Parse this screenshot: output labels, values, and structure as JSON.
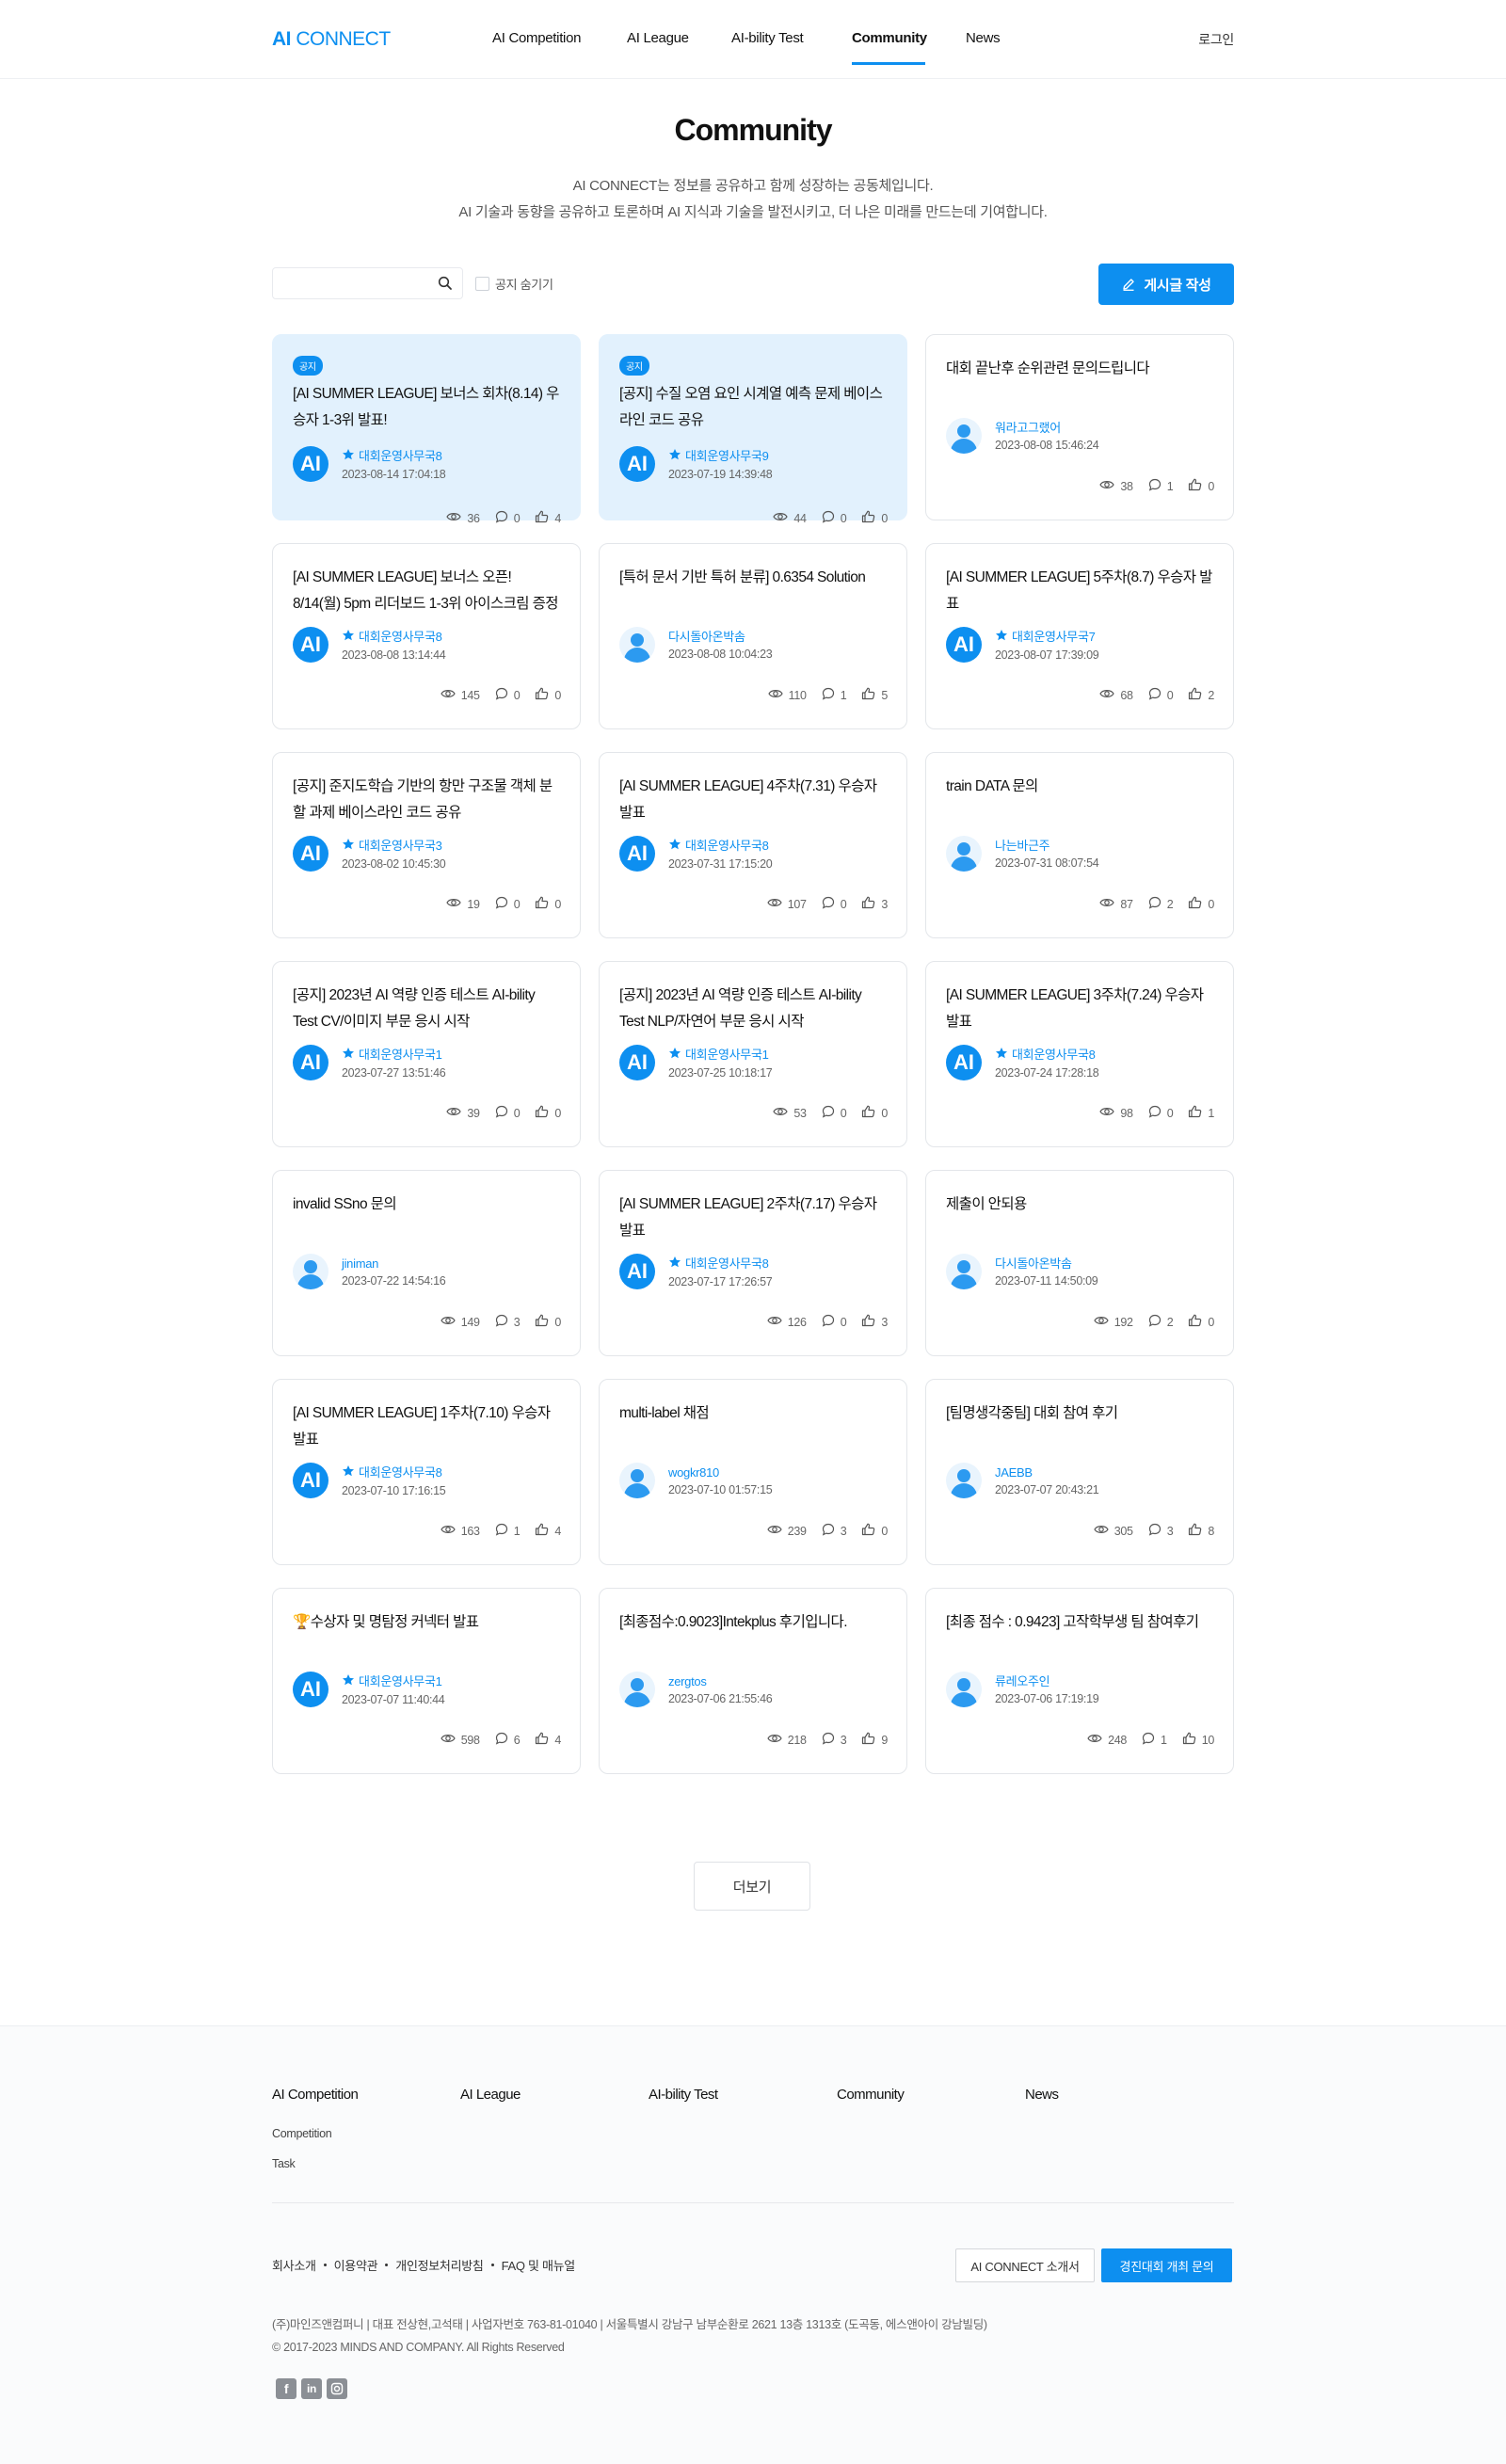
{
  "header": {
    "logo_bold": "AI",
    "logo_rest": " CONNECT",
    "nav": [
      "AI Competition",
      "AI League",
      "AI-bility Test",
      "Community",
      "News"
    ],
    "login": "로그인"
  },
  "intro": {
    "title": "Community",
    "line1": "AI CONNECT는 정보를 공유하고 함께 성장하는 공동체입니다.",
    "line2": "AI 기술과 동향을 공유하고 토론하며 AI 지식과 기술을 발전시키고, 더 나은 미래를 만드는데 기여합니다."
  },
  "toolbar": {
    "search_placeholder": "",
    "hide_notice_label": "공지 숨기기",
    "write_label": "게시글 작성"
  },
  "badge_label": "공지",
  "avatar_ai_text": "AI",
  "posts": [
    {
      "notice": true,
      "title": "[AI SUMMER LEAGUE] 보너스 회차(8.14) 우승자 1-3위 발표!",
      "author": "대회운영사무국8",
      "official": true,
      "date": "2023-08-14 17:04:18",
      "views": "36",
      "comments": "0",
      "likes": "4"
    },
    {
      "notice": true,
      "title": "[공지] 수질 오염 요인 시계열 예측 문제 베이스라인 코드 공유",
      "author": "대회운영사무국9",
      "official": true,
      "date": "2023-07-19 14:39:48",
      "views": "44",
      "comments": "0",
      "likes": "0"
    },
    {
      "notice": false,
      "title": "대회 끝난후 순위관련 문의드립니다",
      "author": "워라고그랬어",
      "official": false,
      "date": "2023-08-08 15:46:24",
      "views": "38",
      "comments": "1",
      "likes": "0"
    },
    {
      "notice": false,
      "title": "[AI SUMMER LEAGUE] 보너스 오픈! 8/14(월) 5pm 리더보드 1-3위 아이스크림 증정 🍨",
      "author": "대회운영사무국8",
      "official": true,
      "date": "2023-08-08 13:14:44",
      "views": "145",
      "comments": "0",
      "likes": "0"
    },
    {
      "notice": false,
      "title": "[특허 문서 기반 특허 분류] 0.6354 Solution",
      "author": "다시돌아온박솜",
      "official": false,
      "date": "2023-08-08 10:04:23",
      "views": "110",
      "comments": "1",
      "likes": "5"
    },
    {
      "notice": false,
      "title": "[AI SUMMER LEAGUE] 5주차(8.7) 우승자 발표",
      "author": "대회운영사무국7",
      "official": true,
      "date": "2023-08-07 17:39:09",
      "views": "68",
      "comments": "0",
      "likes": "2"
    },
    {
      "notice": false,
      "title": "[공지] 준지도학습 기반의 항만 구조물 객체 분할 과제 베이스라인 코드 공유",
      "author": "대회운영사무국3",
      "official": true,
      "date": "2023-08-02 10:45:30",
      "views": "19",
      "comments": "0",
      "likes": "0"
    },
    {
      "notice": false,
      "title": "[AI SUMMER LEAGUE] 4주차(7.31) 우승자 발표",
      "author": "대회운영사무국8",
      "official": true,
      "date": "2023-07-31 17:15:20",
      "views": "107",
      "comments": "0",
      "likes": "3"
    },
    {
      "notice": false,
      "title": "train DATA 문의",
      "author": "나는바근주",
      "official": false,
      "date": "2023-07-31 08:07:54",
      "views": "87",
      "comments": "2",
      "likes": "0"
    },
    {
      "notice": false,
      "title": "[공지] 2023년 AI 역량 인증 테스트 AI-bility Test CV/이미지 부문 응시 시작",
      "author": "대회운영사무국1",
      "official": true,
      "date": "2023-07-27 13:51:46",
      "views": "39",
      "comments": "0",
      "likes": "0"
    },
    {
      "notice": false,
      "title": "[공지] 2023년 AI 역량 인증 테스트 AI-bility Test NLP/자연어 부문 응시 시작",
      "author": "대회운영사무국1",
      "official": true,
      "date": "2023-07-25 10:18:17",
      "views": "53",
      "comments": "0",
      "likes": "0"
    },
    {
      "notice": false,
      "title": "[AI SUMMER LEAGUE] 3주차(7.24) 우승자 발표",
      "author": "대회운영사무국8",
      "official": true,
      "date": "2023-07-24 17:28:18",
      "views": "98",
      "comments": "0",
      "likes": "1"
    },
    {
      "notice": false,
      "title": "invalid SSno 문의",
      "author": "jiniman",
      "official": false,
      "date": "2023-07-22 14:54:16",
      "views": "149",
      "comments": "3",
      "likes": "0"
    },
    {
      "notice": false,
      "title": "[AI SUMMER LEAGUE] 2주차(7.17) 우승자 발표",
      "author": "대회운영사무국8",
      "official": true,
      "date": "2023-07-17 17:26:57",
      "views": "126",
      "comments": "0",
      "likes": "3"
    },
    {
      "notice": false,
      "title": "제출이 안되용",
      "author": "다시돌아온박솜",
      "official": false,
      "date": "2023-07-11 14:50:09",
      "views": "192",
      "comments": "2",
      "likes": "0"
    },
    {
      "notice": false,
      "title": "[AI SUMMER LEAGUE] 1주차(7.10) 우승자 발표",
      "author": "대회운영사무국8",
      "official": true,
      "date": "2023-07-10 17:16:15",
      "views": "163",
      "comments": "1",
      "likes": "4"
    },
    {
      "notice": false,
      "title": "multi-label 채점",
      "author": "wogkr810",
      "official": false,
      "date": "2023-07-10 01:57:15",
      "views": "239",
      "comments": "3",
      "likes": "0"
    },
    {
      "notice": false,
      "title": "[팀명생각중팀] 대회 참여 후기",
      "author": "JAEBB",
      "official": false,
      "date": "2023-07-07 20:43:21",
      "views": "305",
      "comments": "3",
      "likes": "8"
    },
    {
      "notice": false,
      "title": "🏆수상자 및 명탐정 커넥터 발표",
      "author": "대회운영사무국1",
      "official": true,
      "date": "2023-07-07 11:40:44",
      "views": "598",
      "comments": "6",
      "likes": "4"
    },
    {
      "notice": false,
      "title": "[최종점수:0.9023]Intekplus 후기입니다.",
      "author": "zergtos",
      "official": false,
      "date": "2023-07-06 21:55:46",
      "views": "218",
      "comments": "3",
      "likes": "9"
    },
    {
      "notice": false,
      "title": "[최종 점수 : 0.9423] 고작학부생 팀 참여후기",
      "author": "류레오주인",
      "official": false,
      "date": "2023-07-06 17:19:19",
      "views": "248",
      "comments": "1",
      "likes": "10"
    }
  ],
  "more_label": "더보기",
  "footer": {
    "columns": [
      "AI Competition",
      "AI League",
      "AI-bility Test",
      "Community",
      "News"
    ],
    "competition_sub": [
      "Competition",
      "Task"
    ],
    "links": [
      "회사소개",
      "이용약관",
      "개인정보처리방침",
      "FAQ 및 매뉴얼"
    ],
    "btn_intro": "AI CONNECT 소개서",
    "btn_inquiry": "경진대회 개최 문의",
    "company_info": "(주)마인즈앤컴퍼니 | 대표 전상현,고석태 | 사업자번호 763-81-01040 | 서울특별시 강남구 남부순환로 2621 13층 1313호 (도곡동, 에스앤아이 강남빌딩)",
    "copyright": "© 2017-2023 MINDS AND COMPANY. All Rights Reserved",
    "social": [
      "facebook-icon",
      "linkedin-icon",
      "instagram-icon"
    ]
  },
  "colors": {
    "accent": "#0d8ff0",
    "notice_bg": "#e2f1fd"
  }
}
